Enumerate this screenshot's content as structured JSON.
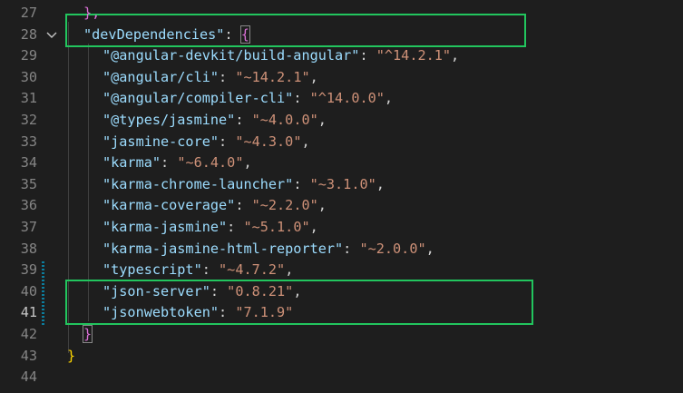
{
  "editor": {
    "lines": [
      {
        "num": "27",
        "tokens": [
          {
            "t": "},",
            "c": "brace-p"
          }
        ]
      },
      {
        "num": "28",
        "tokens": [
          {
            "t": "\"devDependencies\"",
            "c": "key"
          },
          {
            "t": ": ",
            "c": "punc"
          },
          {
            "t": "{",
            "c": "brace-p"
          }
        ]
      },
      {
        "num": "29",
        "tokens": [
          {
            "t": "\"@angular-devkit/build-angular\"",
            "c": "key"
          },
          {
            "t": ": ",
            "c": "punc"
          },
          {
            "t": "\"^14.2.1\"",
            "c": "str"
          },
          {
            "t": ",",
            "c": "punc"
          }
        ]
      },
      {
        "num": "30",
        "tokens": [
          {
            "t": "\"@angular/cli\"",
            "c": "key"
          },
          {
            "t": ": ",
            "c": "punc"
          },
          {
            "t": "\"~14.2.1\"",
            "c": "str"
          },
          {
            "t": ",",
            "c": "punc"
          }
        ]
      },
      {
        "num": "31",
        "tokens": [
          {
            "t": "\"@angular/compiler-cli\"",
            "c": "key"
          },
          {
            "t": ": ",
            "c": "punc"
          },
          {
            "t": "\"^14.0.0\"",
            "c": "str"
          },
          {
            "t": ",",
            "c": "punc"
          }
        ]
      },
      {
        "num": "32",
        "tokens": [
          {
            "t": "\"@types/jasmine\"",
            "c": "key"
          },
          {
            "t": ": ",
            "c": "punc"
          },
          {
            "t": "\"~4.0.0\"",
            "c": "str"
          },
          {
            "t": ",",
            "c": "punc"
          }
        ]
      },
      {
        "num": "33",
        "tokens": [
          {
            "t": "\"jasmine-core\"",
            "c": "key"
          },
          {
            "t": ": ",
            "c": "punc"
          },
          {
            "t": "\"~4.3.0\"",
            "c": "str"
          },
          {
            "t": ",",
            "c": "punc"
          }
        ]
      },
      {
        "num": "34",
        "tokens": [
          {
            "t": "\"karma\"",
            "c": "key"
          },
          {
            "t": ": ",
            "c": "punc"
          },
          {
            "t": "\"~6.4.0\"",
            "c": "str"
          },
          {
            "t": ",",
            "c": "punc"
          }
        ]
      },
      {
        "num": "35",
        "tokens": [
          {
            "t": "\"karma-chrome-launcher\"",
            "c": "key"
          },
          {
            "t": ": ",
            "c": "punc"
          },
          {
            "t": "\"~3.1.0\"",
            "c": "str"
          },
          {
            "t": ",",
            "c": "punc"
          }
        ]
      },
      {
        "num": "36",
        "tokens": [
          {
            "t": "\"karma-coverage\"",
            "c": "key"
          },
          {
            "t": ": ",
            "c": "punc"
          },
          {
            "t": "\"~2.2.0\"",
            "c": "str"
          },
          {
            "t": ",",
            "c": "punc"
          }
        ]
      },
      {
        "num": "37",
        "tokens": [
          {
            "t": "\"karma-jasmine\"",
            "c": "key"
          },
          {
            "t": ": ",
            "c": "punc"
          },
          {
            "t": "\"~5.1.0\"",
            "c": "str"
          },
          {
            "t": ",",
            "c": "punc"
          }
        ]
      },
      {
        "num": "38",
        "tokens": [
          {
            "t": "\"karma-jasmine-html-reporter\"",
            "c": "key"
          },
          {
            "t": ": ",
            "c": "punc"
          },
          {
            "t": "\"~2.0.0\"",
            "c": "str"
          },
          {
            "t": ",",
            "c": "punc"
          }
        ]
      },
      {
        "num": "39",
        "tokens": [
          {
            "t": "\"typescript\"",
            "c": "key"
          },
          {
            "t": ": ",
            "c": "punc"
          },
          {
            "t": "\"~4.7.2\"",
            "c": "str"
          },
          {
            "t": ",",
            "c": "punc"
          }
        ]
      },
      {
        "num": "40",
        "tokens": [
          {
            "t": "\"json-server\"",
            "c": "key"
          },
          {
            "t": ": ",
            "c": "punc"
          },
          {
            "t": "\"0.8.21\"",
            "c": "str"
          },
          {
            "t": ",",
            "c": "punc"
          }
        ]
      },
      {
        "num": "41",
        "tokens": [
          {
            "t": "\"jsonwebtoken\"",
            "c": "key"
          },
          {
            "t": ": ",
            "c": "punc"
          },
          {
            "t": "\"7.1.9\"",
            "c": "str"
          }
        ]
      },
      {
        "num": "42",
        "tokens": [
          {
            "t": "}",
            "c": "brace-p"
          }
        ]
      },
      {
        "num": "43",
        "tokens": [
          {
            "t": "}",
            "c": "brace-y"
          }
        ]
      },
      {
        "num": "44",
        "tokens": []
      }
    ],
    "active_line": "41",
    "colors": {
      "background": "#1e1e1e",
      "key": "#9cdcfe",
      "string": "#ce9178",
      "highlight_box": "#22c55e",
      "modified_marker": "#0c7d9d"
    },
    "fold_icon": "chevron-down-icon"
  }
}
